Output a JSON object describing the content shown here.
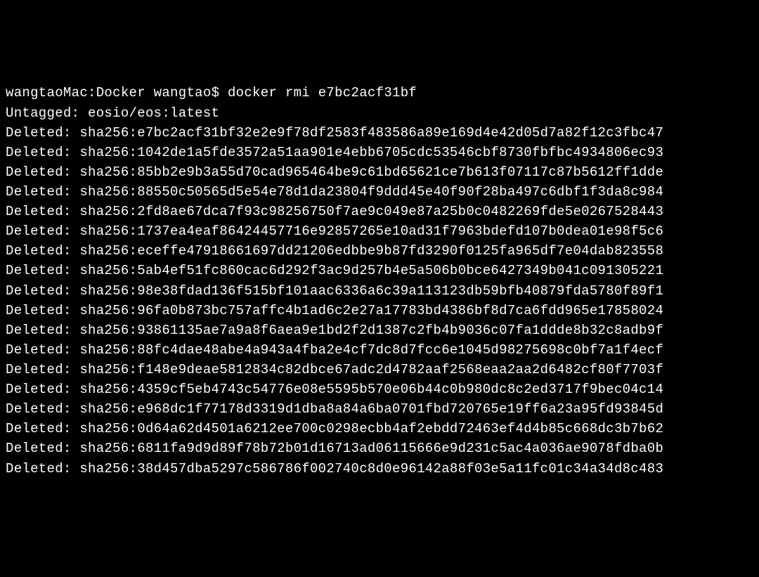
{
  "prompt": {
    "host": "wangtaoMac",
    "path": "Docker",
    "user": "wangtao",
    "symbol": "$",
    "command": "docker rmi e7bc2acf31bf"
  },
  "untagged": {
    "label": "Untagged:",
    "value": "eosio/eos:latest"
  },
  "deleted_label": "Deleted:",
  "sha_prefix": "sha256:",
  "deleted": [
    "e7bc2acf31bf32e2e9f78df2583f483586a89e169d4e42d05d7a82f12c3fbc47",
    "1042de1a5fde3572a51aa901e4ebb6705cdc53546cbf8730fbfbc4934806ec93",
    "85bb2e9b3a55d70cad965464be9c61bd65621ce7b613f07117c87b5612ff1dde",
    "88550c50565d5e54e78d1da23804f9ddd45e40f90f28ba497c6dbf1f3da8c984",
    "2fd8ae67dca7f93c98256750f7ae9c049e87a25b0c0482269fde5e0267528443",
    "1737ea4eaf86424457716e92857265e10ad31f7963bdefd107b0dea01e98f5c6",
    "eceffe47918661697dd21206edbbe9b87fd3290f0125fa965df7e04dab823558",
    "5ab4ef51fc860cac6d292f3ac9d257b4e5a506b0bce6427349b041c091305221",
    "98e38fdad136f515bf101aac6336a6c39a113123db59bfb40879fda5780f89f1",
    "96fa0b873bc757affc4b1ad6c2e27a17783bd4386bf8d7ca6fdd965e17858024",
    "93861135ae7a9a8f6aea9e1bd2f2d1387c2fb4b9036c07fa1ddde8b32c8adb9f",
    "88fc4dae48abe4a943a4fba2e4cf7dc8d7fcc6e1045d98275698c0bf7a1f4ecf",
    "f148e9deae5812834c82dbce67adc2d4782aaf2568eaa2aa2d6482cf80f7703f",
    "4359cf5eb4743c54776e08e5595b570e06b44c0b980dc8c2ed3717f9bec04c14",
    "e968dc1f77178d3319d1dba8a84a6ba0701fbd720765e19ff6a23a95fd93845d",
    "0d64a62d4501a6212ee700c0298ecbb4af2ebdd72463ef4d4b85c668dc3b7b62",
    "6811fa9d9d89f78b72b01d16713ad06115666e9d231c5ac4a036ae9078fdba0b",
    "38d457dba5297c586786f002740c8d0e96142a88f03e5a11fc01c34a34d8c483"
  ]
}
